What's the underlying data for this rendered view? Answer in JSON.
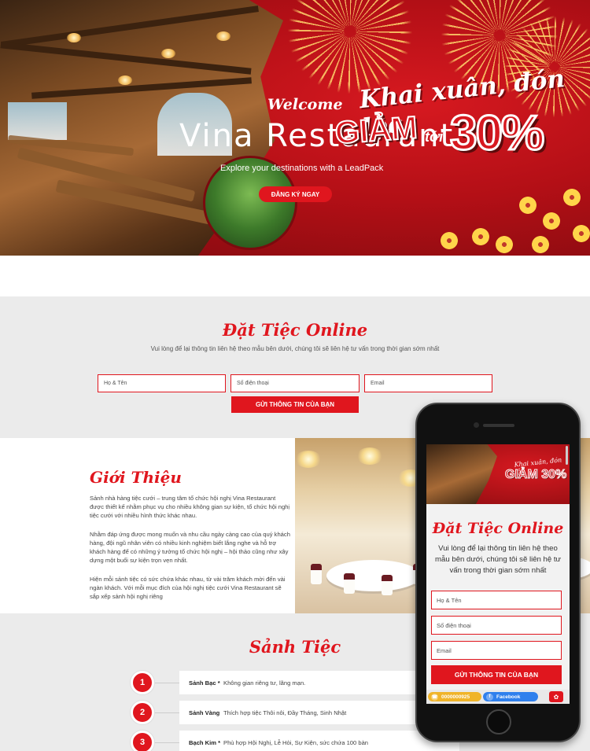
{
  "hero": {
    "welcome": "Welcome",
    "title": "Vina Restaurant",
    "subtitle": "Explore your destinations with a LeadPack",
    "cta_label": "ĐĂNG KÝ NGAY",
    "promo_top": "Khai xuân, đón lộc",
    "promo_giam": "GIẢM",
    "promo_toi": "tới",
    "promo_percent": "30%"
  },
  "booking": {
    "title": "Đặt Tiệc Online",
    "description": "Vui lòng để lại thông tin liên hệ theo mẫu bên dưới, chúng tôi sẽ liên hệ tư vấn trong thời gian sớm nhất",
    "name_placeholder": "Họ & Tên",
    "phone_placeholder": "Số điện thoại",
    "email_placeholder": "Email",
    "submit_label": "GỬI THÔNG TIN CỦA BẠN"
  },
  "intro": {
    "title": "Giới Thiệu",
    "paragraphs": [
      "Sảnh nhà hàng tiệc cưới – trung tâm tổ chức hội nghị Vina Restaurant được thiết kế nhằm phục vụ cho nhiều không gian sự kiện, tổ chức hội nghị tiệc cưới với nhiều hình thức khác nhau.",
      "Nhằm đáp ứng được mong muốn và nhu cầu ngày càng cao của quý khách hàng, đội ngũ nhân viên có nhiều kinh nghiệm biết lắng nghe và hỗ trợ khách hàng để có những ý tưởng tổ chức hội nghị – hội thảo cũng như xây dựng một buổi sự kiện trọn vẹn nhất.",
      "Hiện mỗi sảnh tiệc có sức chứa khác nhau, từ vài trăm khách mời đến vài ngàn khách. Với mỗi mục đích của hội nghị tiệc cưới Vina Restaurant sẽ sắp xếp sảnh hội nghị riêng"
    ]
  },
  "halls": {
    "title": "Sảnh Tiệc",
    "items": [
      {
        "num": "1",
        "name": "Sảnh Bạc *",
        "desc": "Không gian riêng tư, lãng mạn."
      },
      {
        "num": "2",
        "name": "Sảnh Vàng",
        "desc": "Thích hợp tiệc Thôi nôi, Đầy Tháng, Sinh Nhật"
      },
      {
        "num": "3",
        "name": "Bạch Kim *",
        "desc": "Phù hợp Hội Nghị, Lễ Hỏi, Sự Kiện, sức chứa 100 bàn"
      }
    ]
  },
  "mobile": {
    "promo_top": "Khai xuân, đón lộc",
    "promo_main": "GIẢM 30%",
    "title": "Đặt Tiệc Online",
    "description": "Vui lòng để lại thông tin liên hệ theo mẫu bên dưới, chúng tôi sẽ liên hệ tư vấn trong thời gian sớm nhất",
    "name_placeholder": "Họ & Tên",
    "phone_placeholder": "Số điện thoại",
    "email_placeholder": "Email",
    "submit_label": "GỬI THÔNG TIN CỦA BẠN",
    "hotline": "0000000925",
    "facebook": "Facebook"
  },
  "colors": {
    "brand_red": "#e0161e",
    "section_gray": "#ebebeb"
  },
  "icons": {
    "call": "phone-icon",
    "facebook": "facebook-icon",
    "messenger": "messenger-icon"
  }
}
